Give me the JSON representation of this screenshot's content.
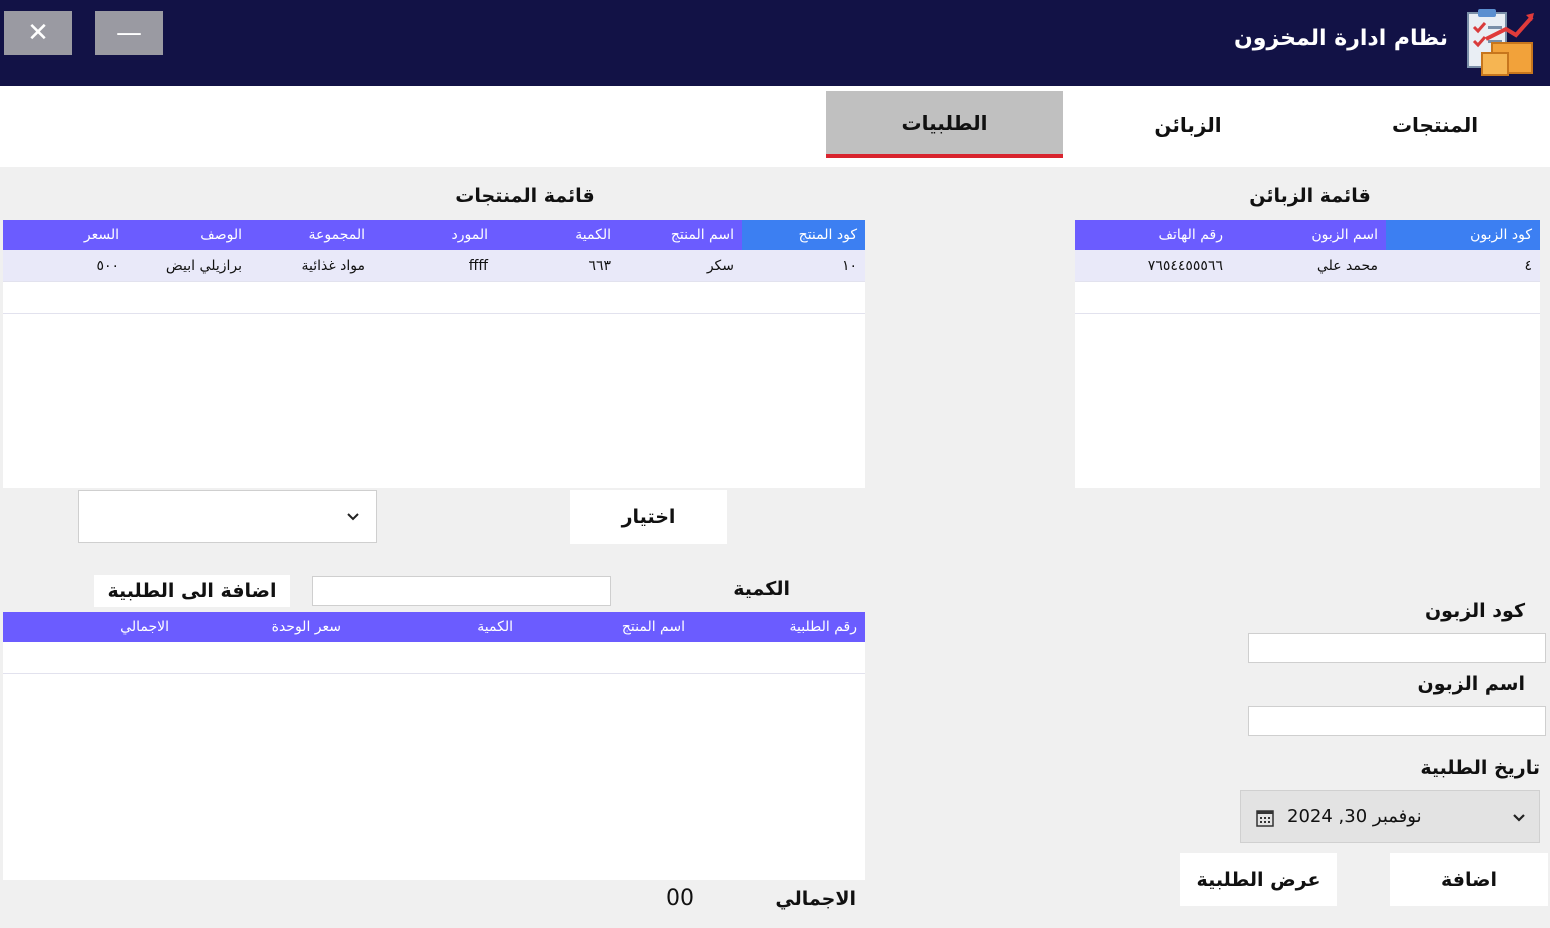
{
  "window": {
    "title": "نظام ادارة المخزون",
    "close_glyph": "✕",
    "minimize_glyph": "—"
  },
  "tabs": [
    {
      "label": "المنتجات"
    },
    {
      "label": "الزبائن"
    },
    {
      "label": "الطلبيات",
      "active": true
    }
  ],
  "customers": {
    "title": "قائمة الزبائن",
    "columns": [
      "كود الزبون",
      "اسم الزبون",
      "رقم الهاتف"
    ],
    "rows": [
      [
        "٤",
        "محمد علي",
        "٧٦٥٤٤٥٥٥٦٦"
      ]
    ]
  },
  "products": {
    "title": "قائمة المنتجات",
    "columns": [
      "كود المنتج",
      "اسم المنتج",
      "الكمية",
      "المورد",
      "المجموعة",
      "الوصف",
      "السعر"
    ],
    "rows": [
      [
        "١٠",
        "سكر",
        "٦٦٣",
        "ffff",
        "مواد غذائية",
        "برازيلي ابيض",
        "٥٠٠"
      ]
    ]
  },
  "select_button": "اختيار",
  "select_dropdown": {
    "value": "",
    "chevron": "⌄"
  },
  "quantity_label": "الكمية",
  "quantity_value": "",
  "add_to_order_button": "اضافة الى الطلبية",
  "order_items": {
    "columns": [
      "رقم الطلبية",
      "اسم المنتج",
      "الكمية",
      "سعر الوحدة",
      "الاجمالي"
    ],
    "rows": []
  },
  "total": {
    "label": "الاجمالي",
    "value": "00"
  },
  "form": {
    "customer_code_label": "كود الزبون",
    "customer_code_value": "",
    "customer_name_label": "اسم الزبون",
    "customer_name_value": "",
    "order_date_label": "تاريخ الطلبية",
    "order_date_value": "نوفمبر 30, 2024"
  },
  "add_button": "اضافة",
  "view_order_button": "عرض الطلبية",
  "colors": {
    "titlebar": "#121246",
    "grid_header": "#6b5cff",
    "grid_header_selected": "#3c7ff2",
    "active_tab_underline": "#d9242e"
  }
}
